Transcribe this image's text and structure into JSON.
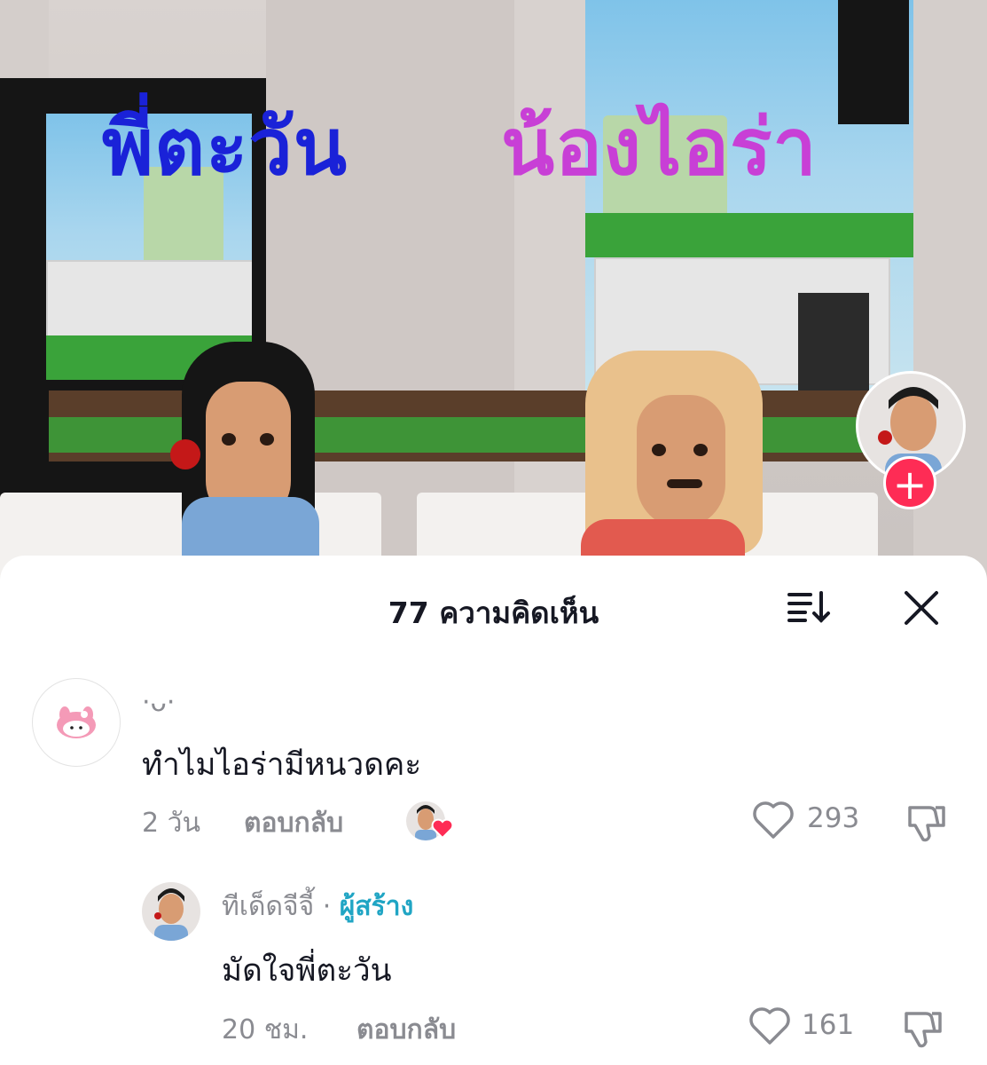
{
  "video": {
    "overlay_left": "พี่ตะวัน",
    "overlay_right": "น้องไอร่า",
    "follow_symbol": "+"
  },
  "comments_sheet": {
    "title": "77 ความคิดเห็น",
    "comments": [
      {
        "username": "·ᴗ·",
        "text": "ทำไมไอร่ามีหนวดคะ",
        "time": "2 วัน",
        "reply_label": "ตอบกลับ",
        "likes": "293"
      },
      {
        "username": "ทีเด็ดจีจี้",
        "separator": "·",
        "badge": "ผู้สร้าง",
        "text": "มัดใจพี่ตะวัน",
        "time": "20 ชม.",
        "reply_label": "ตอบกลับ",
        "likes": "161"
      }
    ]
  },
  "colors": {
    "accent_red": "#fe2c55",
    "creator_badge": "#20a5c4",
    "overlay_blue": "#1a22d8",
    "overlay_purple": "#c83fd6"
  }
}
